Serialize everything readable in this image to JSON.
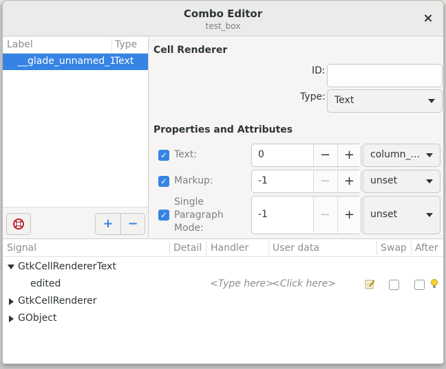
{
  "window": {
    "title": "Combo Editor",
    "subtitle": "test_box",
    "close_glyph": "×"
  },
  "list": {
    "headers": {
      "label": "Label",
      "type": "Type"
    },
    "rows": [
      {
        "label": "__glade_unnamed_1",
        "type": "Text",
        "selected": true
      }
    ],
    "toolbar": {
      "help_icon": "lifebuoy-icon",
      "add_glyph": "+",
      "remove_glyph": "−"
    }
  },
  "cell_renderer": {
    "section_title": "Cell Renderer",
    "id_label": "ID:",
    "id_value": "",
    "type_label": "Type:",
    "type_value": "Text"
  },
  "properties": {
    "section_title": "Properties and Attributes",
    "rows": [
      {
        "label": "Text:",
        "checked": true,
        "value": "0",
        "minus_enabled": true,
        "attribute": "column_..."
      },
      {
        "label": "Markup:",
        "checked": true,
        "value": "-1",
        "minus_enabled": false,
        "attribute": "unset"
      },
      {
        "label": "Single Paragraph Mode:",
        "checked": true,
        "value": "-1",
        "minus_enabled": false,
        "attribute": "unset"
      }
    ],
    "minus_glyph": "−",
    "plus_glyph": "+"
  },
  "signals": {
    "headers": {
      "signal": "Signal",
      "detail": "Detail",
      "handler": "Handler",
      "user_data": "User data",
      "swap": "Swap",
      "after": "After"
    },
    "rows": [
      {
        "name": "GtkCellRendererText",
        "expanded": true
      },
      {
        "name": "edited",
        "handler_placeholder": "<Type here>",
        "user_data_placeholder": "<Click here>"
      },
      {
        "name": "GtkCellRenderer",
        "expanded": false
      },
      {
        "name": "GObject",
        "expanded": false
      }
    ]
  },
  "colors": {
    "accent": "#3584e4",
    "window_bg": "#f6f5f4",
    "text": "#2e3436",
    "dim_text": "#8a8e8f"
  }
}
